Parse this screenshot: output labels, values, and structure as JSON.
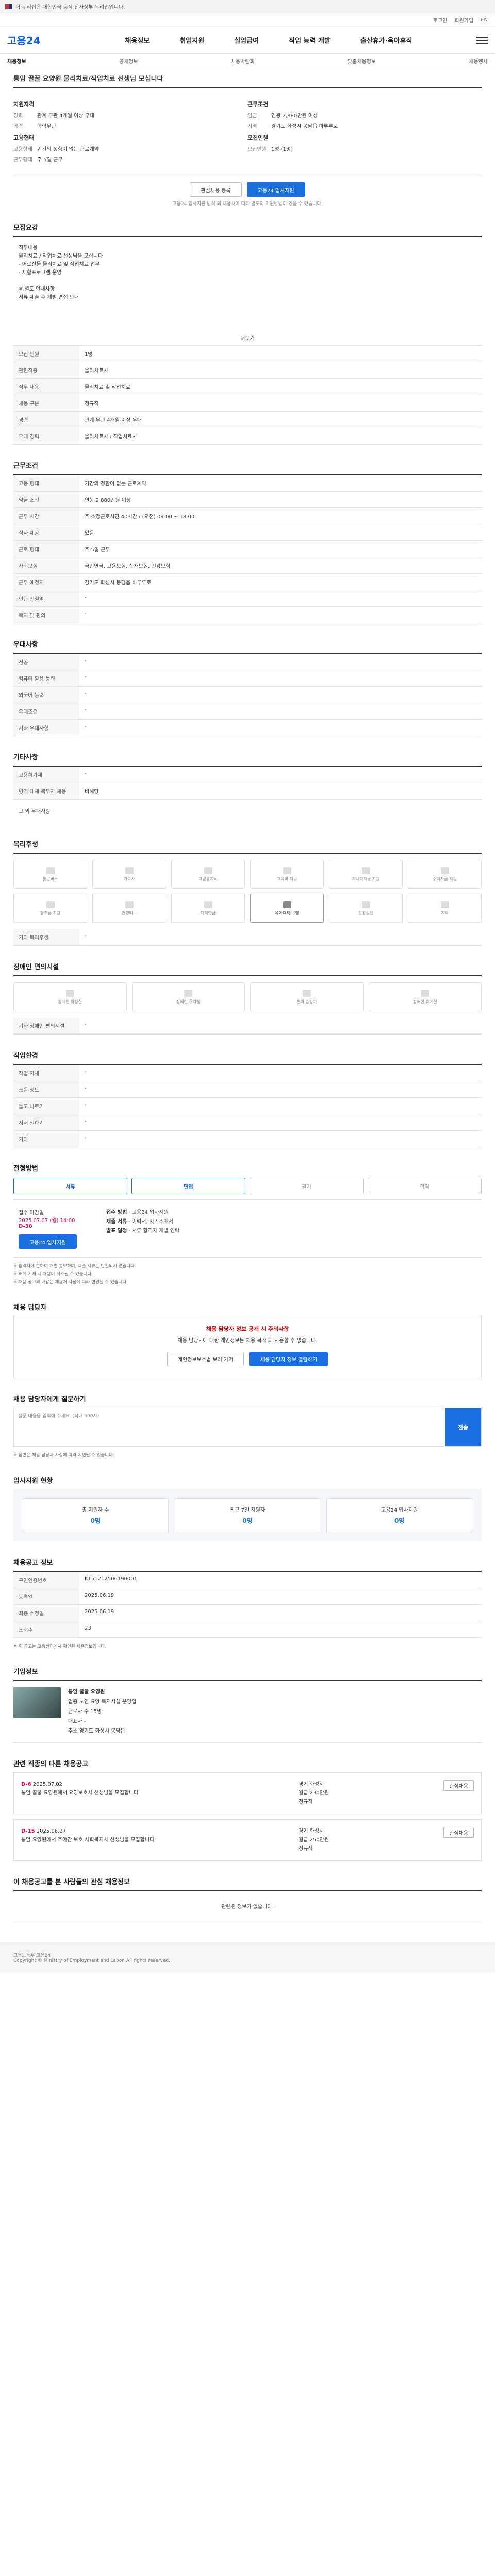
{
  "gov": {
    "text": "이 누리집은 대한민국 공식 전자정부 누리집입니다."
  },
  "util": {
    "login": "로그인",
    "join": "회원가입",
    "lang": "EN"
  },
  "logo": "고용24",
  "gnb": [
    "채용정보",
    "취업지원",
    "실업급여",
    "직업 능력 개발",
    "출산휴가·육아휴직"
  ],
  "lnb": {
    "current": "채용정보",
    "items": [
      "공채정보",
      "채용박람회",
      "맞춤채용정보",
      "채용행사"
    ]
  },
  "job": {
    "title": "통암 꿀꿀 요양원 물리치료/작업치료 선생님 모십니다",
    "company_title": "지원자격",
    "company": {
      "경력": "관계 무관 4개월 이상 우대",
      "학력": "학력무관"
    },
    "cond_title": "근무조건",
    "cond": {
      "임금": "연봉 2,880만원 이상",
      "지역": "경기도 화성시 봉담읍 하루루로"
    },
    "rec_title": "고용형태",
    "rec": {
      "고용형태": "기간의 정함이 없는 근로계약",
      "근무형태": "주 5일 근무"
    },
    "apply_title": "모집인원",
    "apply": {
      "모집인원": "1명 (1명)"
    },
    "scrap_label": "관심채용 등록",
    "apply_label": "고용24 입사지원",
    "notice": "고용24 입사지원 방식 외 채용처에 따라 별도의 지원방법이 있을 수 있습니다."
  },
  "recruit_section": {
    "title": "모집요강",
    "desc_lines": [
      "직무내용",
      "물리치료 / 작업치료 선생님을 모십니다",
      "- 어르신들 물리치료 및 작업치료 업무",
      "- 재활프로그램 운영",
      "",
      "※ 별도 안내사항",
      "서류 제출 후 개별 면접 안내"
    ],
    "more": "더보기"
  },
  "job_info": [
    {
      "k": "모집 인원",
      "v": "1명"
    },
    {
      "k": "관련직종",
      "v": "물리치료사"
    },
    {
      "k": "직무 내용",
      "v": "물리치료 및 작업치료"
    },
    {
      "k": "채용 구분",
      "v": "정규직"
    },
    {
      "k": "경력",
      "v": "관계 무관 4개월 이상 우대"
    },
    {
      "k": "우대 경력",
      "v": "물리치료사 / 작업치료사"
    }
  ],
  "work_section": {
    "title": "근무조건"
  },
  "work_info": [
    {
      "k": "고용 형태",
      "v": "기간의 정함이 없는 근로계약"
    },
    {
      "k": "임금 조건",
      "v": "연봉 2,880만원 이상"
    },
    {
      "k": "근무 시간",
      "v": "주 소정근로시간 40시간 / (오전) 09:00 ~ 18:00"
    },
    {
      "k": "식사 제공",
      "v": "있음"
    },
    {
      "k": "근로 형태",
      "v": "주 5일 근무"
    },
    {
      "k": "사회보험",
      "v": "국민연금, 고용보험, 산재보험, 건강보험"
    },
    {
      "k": "근무 예정지",
      "v": "경기도 화성시 봉담읍 하루루로"
    },
    {
      "k": "인근 전철역",
      "v": "-"
    },
    {
      "k": "복지 및 편의",
      "v": "-"
    }
  ],
  "qual_section": {
    "title": "우대사항"
  },
  "qual_info": [
    {
      "k": "전공",
      "v": "-"
    },
    {
      "k": "컴퓨터 활용 능력",
      "v": "-"
    },
    {
      "k": "외국어 능력",
      "v": "-"
    },
    {
      "k": "우대조건",
      "v": "-"
    },
    {
      "k": "기타 우대사항",
      "v": "-"
    }
  ],
  "tech_section": {
    "title": "기타사항",
    "rows": [
      {
        "k": "고용허가제",
        "v": "-"
      },
      {
        "k": "병역 대체 복무자 채용",
        "v": "비해당"
      }
    ],
    "empty": "그 외 우대사항"
  },
  "welfare_section": {
    "title": "복리후생",
    "items": [
      "통근버스",
      "기숙사",
      "차량유지비",
      "교육비 지원",
      "자녀학자금 지원",
      "주택자금 지원",
      "경조금 지원",
      "인센티브",
      "퇴직연금",
      "육아휴직 보장",
      "건강검진",
      "기타"
    ],
    "active": [
      9
    ],
    "etc_label": "기타 복리후생",
    "etc_value": "-"
  },
  "disabled_section": {
    "title": "장애인 편의시설",
    "items": [
      "장애인 화장실",
      "장애인 주차장",
      "편의 승강기",
      "장애인 휴게실"
    ],
    "note_label": "기타 장애인 편의시설",
    "note_value": "-"
  },
  "work_env": {
    "title": "작업환경",
    "rows": [
      {
        "k": "작업 자세",
        "v": "-"
      },
      {
        "k": "소음 정도",
        "v": "-"
      },
      {
        "k": "들고 나르기",
        "v": "-"
      },
      {
        "k": "서서 일하기",
        "v": "-"
      },
      {
        "k": "기타",
        "v": "-"
      }
    ]
  },
  "process_section": {
    "title": "전형방법",
    "steps": [
      "서류",
      "면접",
      "필기",
      "합격"
    ],
    "active": [
      0,
      1
    ]
  },
  "receipt": {
    "title": "접수 마감일",
    "deadline": "2025.07.07 (월) 14:00",
    "dday": "D-30",
    "method_title": "접수 방법",
    "method": "고용24 입사지원",
    "docs_title": "제출 서류",
    "docs": "이력서, 자기소개서",
    "announce_title": "발표 일정",
    "announce": "서류 합격자 개별 연락"
  },
  "notes": [
    "※ 합격자에 한하여 개별 통보하며, 제출 서류는 반환되지 않습니다.",
    "※ 허위 기재 시 채용이 취소될 수 있습니다.",
    "※ 채용 공고의 내용은 채용처 사정에 따라 변경될 수 있습니다."
  ],
  "manager": {
    "title": "채용 담당자",
    "warn": "채용 담당자 정보 공개 시 주의사항",
    "text": "채용 담당자에 대한 개인정보는 채용 목적 외 사용할 수 없습니다.",
    "btn1": "개인정보보호법 보러 가기",
    "btn2": "채용 담당자 정보 열람하기"
  },
  "qna": {
    "title": "채용 담당자에게 질문하기",
    "placeholder": "질문 내용을 입력해 주세요. (최대 500자)",
    "count": "0/500",
    "send": "전송",
    "note": "※ 답변은 채용 담당자 사정에 따라 지연될 수 있습니다."
  },
  "stats": {
    "title": "입사지원 현황",
    "items": [
      {
        "label": "총 지원자 수",
        "value": "0명"
      },
      {
        "label": "최근 7일 지원자",
        "value": "0명"
      },
      {
        "label": "고용24 입사지원",
        "value": "0명"
      }
    ]
  },
  "info_section": {
    "title": "채용공고 정보",
    "rows": [
      {
        "k": "구인인증번호",
        "v": "K151212506190001"
      },
      {
        "k": "등록일",
        "v": "2025.06.19"
      },
      {
        "k": "최종 수정일",
        "v": "2025.06.19"
      },
      {
        "k": "조회수",
        "v": "23"
      }
    ],
    "note": "※ 위 공고는 고용센터에서 확인된 채용정보입니다."
  },
  "company_section": {
    "title": "기업정보",
    "name": "통암 꿀꿀 요양원",
    "rows": [
      {
        "k": "업종",
        "v": "노인 요양 복지시설 운영업"
      },
      {
        "k": "근로자 수",
        "v": "15명"
      },
      {
        "k": "대표자",
        "v": "-"
      },
      {
        "k": "주소",
        "v": "경기도 화성시 봉담읍"
      }
    ]
  },
  "other_jobs": {
    "title": "관련 직종의 다른 채용공고",
    "cards": [
      {
        "dday": "D-6",
        "date": "2025.07.02",
        "title": "통암 꿀꿀 요양원에서 요양보호사 선생님을 모집합니다",
        "loc": "경기 화성시",
        "pay": "월급 230만원",
        "type": "정규직",
        "btn": "관심채용"
      },
      {
        "dday": "D-15",
        "date": "2025.06.27",
        "title": "통암 요양원에서 주야간 보호 사회복지사 선생님을 모집합니다",
        "loc": "경기 화성시",
        "pay": "월급 250만원",
        "type": "정규직",
        "btn": "관심채용"
      }
    ]
  },
  "viewers": {
    "title": "이 채용공고를 본 사람들의 관심 채용정보",
    "empty": "관련된 정보가 없습니다."
  },
  "footer": {
    "line1": "고용노동부 고용24",
    "line2": "Copyright © Ministry of Employment and Labor. All rights reserved."
  }
}
